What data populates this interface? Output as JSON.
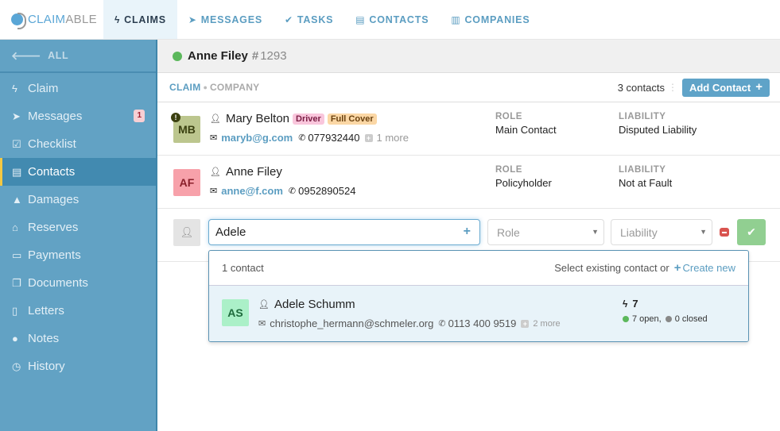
{
  "app": {
    "logo_part1": "CLAIM",
    "logo_part2": "ABLE"
  },
  "topnav": {
    "tabs": [
      {
        "label": "CLAIMS",
        "icon": "bolt-icon",
        "active": true
      },
      {
        "label": "MESSAGES",
        "icon": "paper-plane-icon",
        "active": false
      },
      {
        "label": "TASKS",
        "icon": "check-icon",
        "active": false
      },
      {
        "label": "CONTACTS",
        "icon": "id-card-icon",
        "active": false
      },
      {
        "label": "COMPANIES",
        "icon": "building-icon",
        "active": false
      }
    ]
  },
  "sidebar": {
    "back_label": "ALL",
    "items": [
      {
        "label": "Claim",
        "icon": "bolt-icon"
      },
      {
        "label": "Messages",
        "icon": "paper-plane-icon",
        "badge": "1"
      },
      {
        "label": "Checklist",
        "icon": "checkbox-icon"
      },
      {
        "label": "Contacts",
        "icon": "id-card-icon",
        "active": true
      },
      {
        "label": "Damages",
        "icon": "warning-icon"
      },
      {
        "label": "Reserves",
        "icon": "bank-icon"
      },
      {
        "label": "Payments",
        "icon": "credit-card-icon"
      },
      {
        "label": "Documents",
        "icon": "files-icon"
      },
      {
        "label": "Letters",
        "icon": "file-text-icon"
      },
      {
        "label": "Notes",
        "icon": "comment-icon"
      },
      {
        "label": "History",
        "icon": "clock-icon"
      }
    ]
  },
  "claim": {
    "name": "Anne Filey",
    "hash": "#",
    "number": "1293",
    "status_color": "#5cb85c"
  },
  "subbar": {
    "crumb_claim": "CLAIM",
    "crumb_sep": "●",
    "crumb_company": "COMPANY",
    "contact_count": "3 contacts",
    "add_contact_label": "Add Contact",
    "add_icon": "+"
  },
  "contacts": [
    {
      "initials": "MB",
      "name": "Mary Belton",
      "tags": [
        "Driver",
        "Full Cover"
      ],
      "email": "maryb@g.com",
      "phone": "077932440",
      "more": "1 more",
      "alert": "!",
      "role_label": "ROLE",
      "role": "Main Contact",
      "liability_label": "LIABILITY",
      "liability": "Disputed Liability"
    },
    {
      "initials": "AF",
      "name": "Anne Filey",
      "email": "anne@f.com",
      "phone": "0952890524",
      "role_label": "ROLE",
      "role": "Policyholder",
      "liability_label": "LIABILITY",
      "liability": "Not at Fault"
    }
  ],
  "new_contact": {
    "search_value": "Adele",
    "role_placeholder": "Role",
    "liability_placeholder": "Liability"
  },
  "dropdown": {
    "count": "1 contact",
    "hint": "Select existing contact or",
    "create_label": "Create new",
    "results": [
      {
        "initials": "AS",
        "name": "Adele Schumm",
        "email": "christophe_hermann@schmeler.org",
        "phone": "0113 400 9519",
        "more": "2 more",
        "claims": "7",
        "open": "7 open,",
        "closed": "0 closed"
      }
    ]
  }
}
